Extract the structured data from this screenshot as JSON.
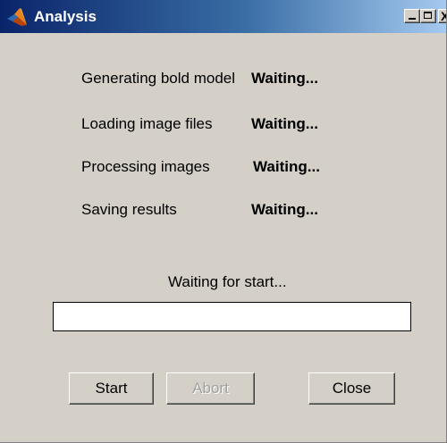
{
  "window": {
    "title": "Analysis",
    "icon": "matlab-icon",
    "controls": {
      "minimize_icon": "minimize-icon",
      "maximize_icon": "maximize-icon",
      "close_icon": "close-icon",
      "close_glyph": "X"
    }
  },
  "steps": [
    {
      "label": "Generating bold model",
      "status": "Waiting..."
    },
    {
      "label": "Loading image files",
      "status": "Waiting..."
    },
    {
      "label": "Processing images",
      "status": "Waiting..."
    },
    {
      "label": "Saving results",
      "status": "Waiting..."
    }
  ],
  "status_message": "Waiting for start...",
  "progress": {
    "fraction": 0
  },
  "buttons": {
    "start": "Start",
    "abort": "Abort",
    "close": "Close"
  },
  "colors": {
    "window_background": "#d4d0c8",
    "titlebar_start": "#0a246a",
    "titlebar_end": "#a6caf0",
    "disabled_text": "#a0a0a0"
  }
}
